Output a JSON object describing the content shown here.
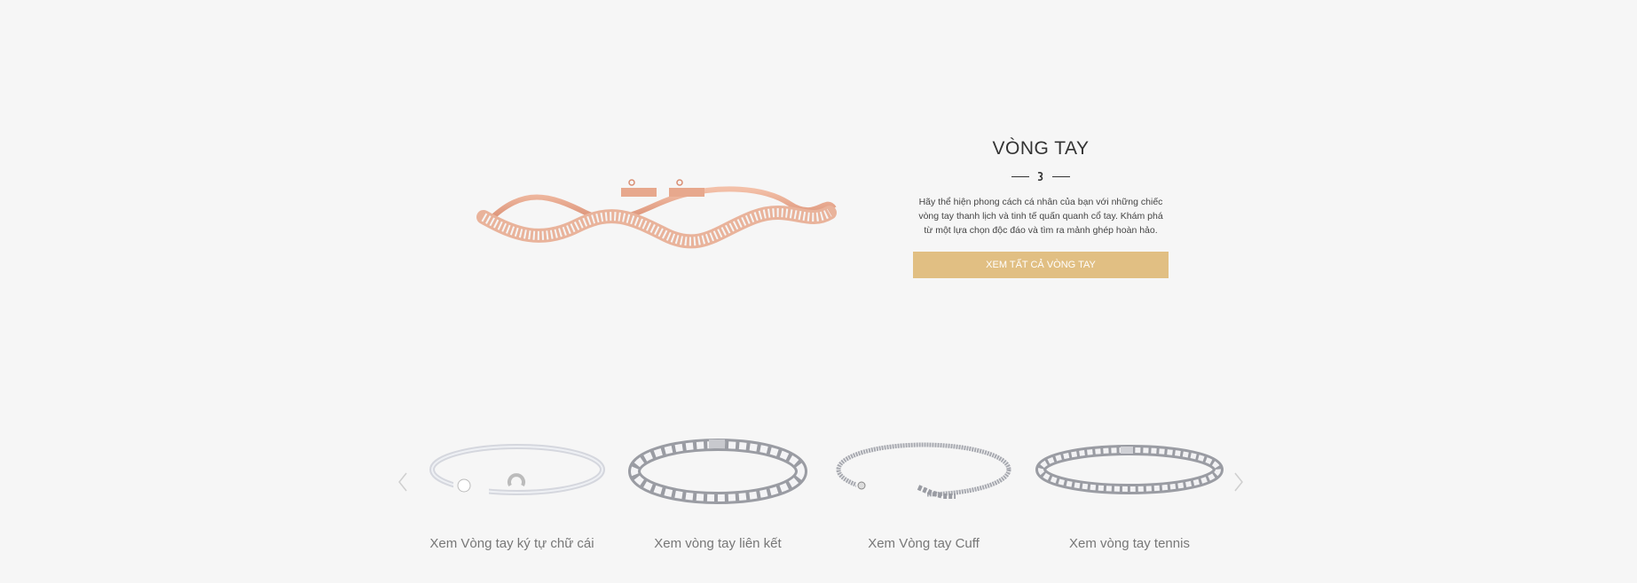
{
  "hero": {
    "title": "VÒNG TAY",
    "description": "Hãy thể hiện phong cách cá nhân của bạn với những chiếc vòng tay thanh lịch và tinh tế quấn quanh cổ tay. Khám phá từ một lựa chọn độc đáo và tìm ra mảnh ghép hoàn hảo.",
    "cta_label": "XEM TẤT CẢ VÒNG TAY",
    "image_icon": "rose-gold-wave-bracelet",
    "accent_color": "#e1bf83"
  },
  "carousel": {
    "prev_icon": "chevron-left-icon",
    "next_icon": "chevron-right-icon",
    "items": [
      {
        "label": "Xem Vòng tay ký tự chữ cái",
        "icon": "letter-bangle-image"
      },
      {
        "label": "Xem vòng tay liên kết",
        "icon": "link-bracelet-image"
      },
      {
        "label": "Xem Vòng tay Cuff",
        "icon": "cuff-bracelet-image"
      },
      {
        "label": "Xem vòng tay tennis",
        "icon": "tennis-bracelet-image"
      }
    ]
  }
}
